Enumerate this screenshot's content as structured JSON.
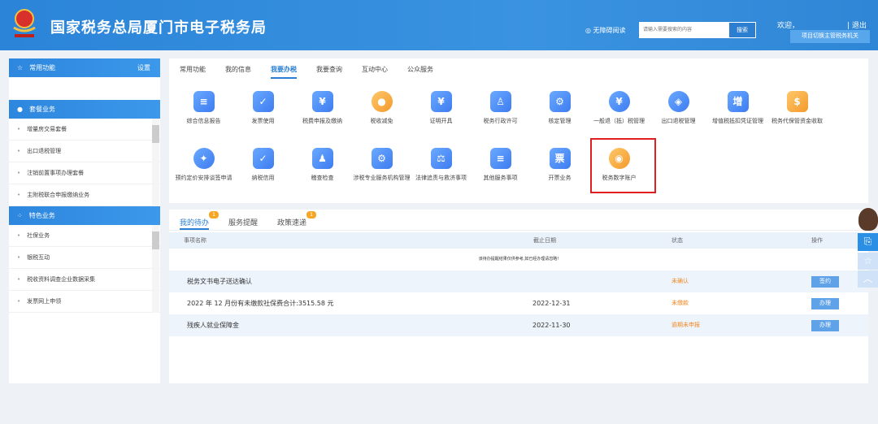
{
  "header": {
    "title": "国家税务总局厦门市电子税务局",
    "access_label": "无障碍阅读",
    "search_placeholder": "请输入需要搜索的内容",
    "search_button": "搜索",
    "welcome": "欢迎，",
    "logout": "| 退出",
    "switch_button": "项目切换主管税务机关",
    "logo_text": "中国税务"
  },
  "sidebar": {
    "common": {
      "title": "常用功能",
      "setting": "设置"
    },
    "package": {
      "title": "套餐业务",
      "items": [
        "增量房交易套餐",
        "出口退税管理",
        "注销前置事项办理套餐",
        "主附税联合申报缴纳业务"
      ]
    },
    "special": {
      "title": "特色业务",
      "items": [
        "社保业务",
        "银税互动",
        "税收资料调查企业数据采集",
        "发票网上申领"
      ]
    }
  },
  "main": {
    "tabs": [
      "常用功能",
      "我的信息",
      "我要办税",
      "我要查询",
      "互动中心",
      "公众服务"
    ],
    "active_tab": "我要办税",
    "services": [
      {
        "label": "综合信息报告",
        "icon": "clipboard-icon",
        "g": "≡"
      },
      {
        "label": "发票使用",
        "icon": "ticket-check-icon",
        "g": "✓"
      },
      {
        "label": "税费申报及缴纳",
        "icon": "wallet-yuan-icon",
        "g": "¥"
      },
      {
        "label": "税收减免",
        "icon": "coin-icon",
        "g": "●"
      },
      {
        "label": "证明开具",
        "icon": "certificate-icon",
        "g": "¥"
      },
      {
        "label": "税务行政许可",
        "icon": "id-badge-icon",
        "g": "♙"
      },
      {
        "label": "核定管理",
        "icon": "user-gear-icon",
        "g": "⚙"
      },
      {
        "label": "一般退（抵）税管理",
        "icon": "refund-cycle-icon",
        "g": "¥"
      },
      {
        "label": "出口退税管理",
        "icon": "globe-icon",
        "g": "◈"
      },
      {
        "label": "增值税抵扣凭证管理",
        "icon": "vat-ticket-icon",
        "g": "增"
      },
      {
        "label": "税务代保管资金收取",
        "icon": "money-bag-hand-icon",
        "g": "$"
      },
      {
        "label": "预约定价安排谈签申请",
        "icon": "compass-icon",
        "g": "✦"
      },
      {
        "label": "纳税信用",
        "icon": "diamond-check-icon",
        "g": "✓"
      },
      {
        "label": "稽查检查",
        "icon": "stamp-icon",
        "g": "♟"
      },
      {
        "label": "涉税专业服务机构管理",
        "icon": "user-gear-icon",
        "g": "⚙"
      },
      {
        "label": "法律追责与救济事项",
        "icon": "gavel-icon",
        "g": "⚖"
      },
      {
        "label": "其他服务事项",
        "icon": "clipboard-icon",
        "g": "≡"
      },
      {
        "label": "开票业务",
        "icon": "invoice-icon",
        "g": "票"
      },
      {
        "label": "税务数字账户",
        "icon": "digital-account-icon",
        "g": "◉"
      }
    ]
  },
  "todo": {
    "tabs": [
      {
        "label": "我的待办",
        "badge": "1"
      },
      {
        "label": "服务提醒",
        "badge": ""
      },
      {
        "label": "政策速递",
        "badge": "1"
      }
    ],
    "columns": [
      "事项名称",
      "截止日期",
      "状态",
      "操作"
    ],
    "notice": "该待办提醒结果仅供参考,如已经办理请忽略!",
    "rows": [
      {
        "name": "税务文书电子送达确认",
        "date": "",
        "status": "未确认",
        "action": "签约"
      },
      {
        "name": "2022 年 12 月份有未缴款社保费合计:3515.58 元",
        "date": "2022-12-31",
        "status": "未缴款",
        "action": "办理"
      },
      {
        "name": "残疾人就业保障金",
        "date": "2022-11-30",
        "status": "逾期未申报",
        "action": "办理"
      }
    ]
  },
  "float": {
    "icons": [
      "assistant-avatar-icon",
      "document-icon",
      "star-icon",
      "chevron-up-icon"
    ]
  },
  "colors": {
    "brand": "#2d87d9",
    "status": "#f08a24",
    "highlight": "#e02020"
  }
}
